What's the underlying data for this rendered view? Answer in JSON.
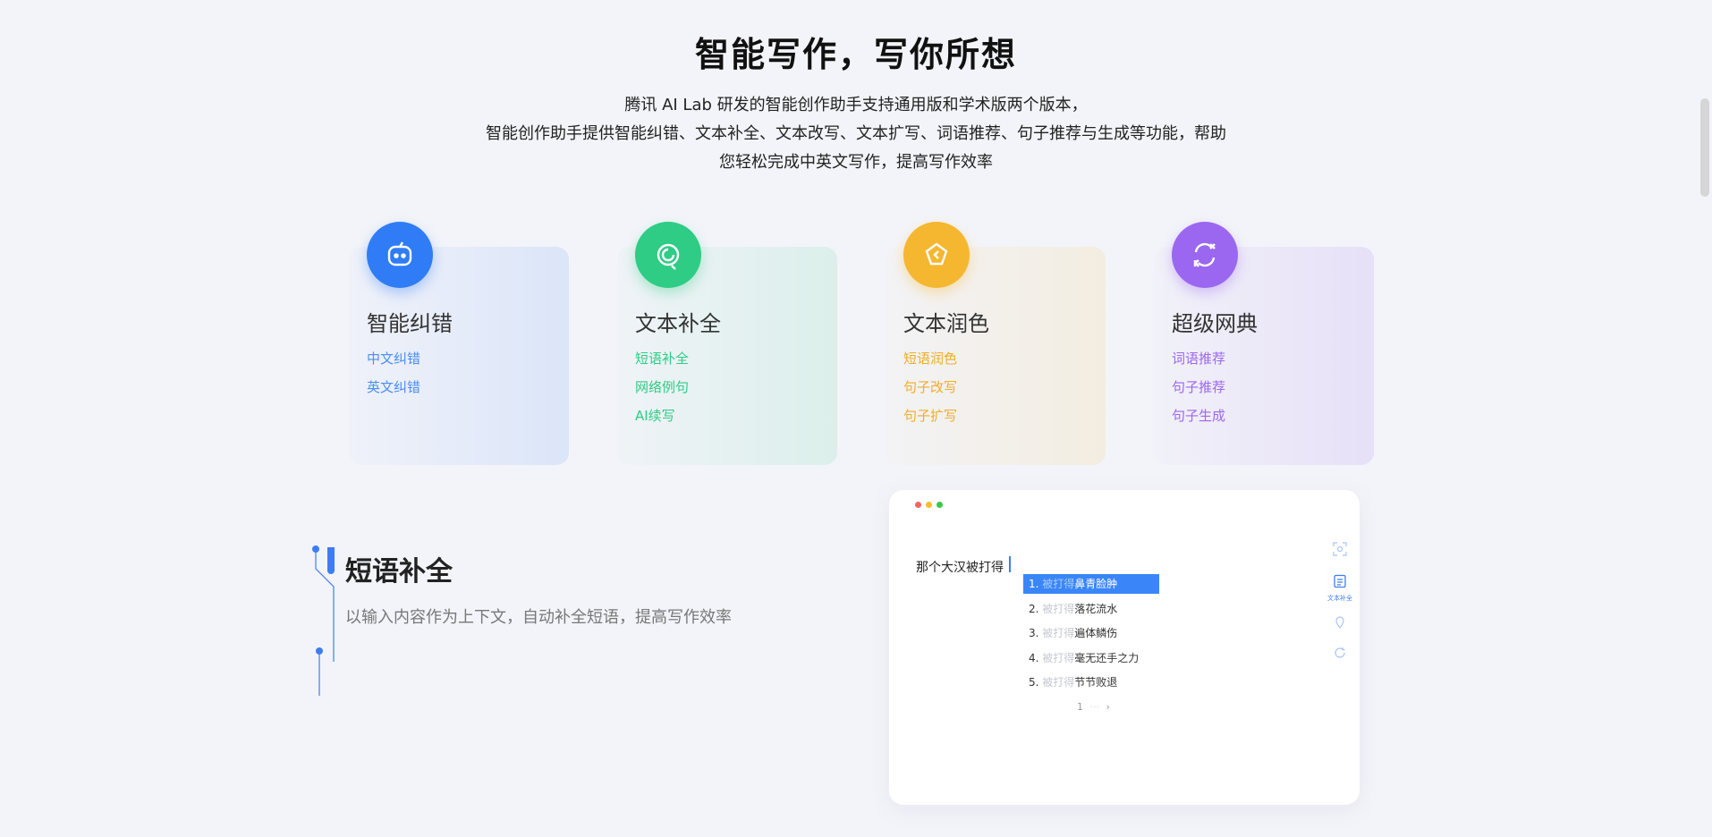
{
  "hero": {
    "title": "智能写作，写你所想",
    "desc_line1": "腾讯 AI Lab 研发的智能创作助手支持通用版和学术版两个版本，",
    "desc_line2": "智能创作助手提供智能纠错、文本补全、文本改写、文本扩写、词语推荐、句子推荐与生成等功能，帮助",
    "desc_line3": "您轻松完成中英文写作，提高写作效率"
  },
  "cards": [
    {
      "title": "智能纠错",
      "icon": "robot-face-icon",
      "accent": "#2f7cf6",
      "links": [
        "中文纠错",
        "英文纠错"
      ]
    },
    {
      "title": "文本补全",
      "icon": "refresh-circle-icon",
      "accent": "#2ecc85",
      "links": [
        "短语补全",
        "网络例句",
        "AI续写"
      ]
    },
    {
      "title": "文本润色",
      "icon": "diamond-icon",
      "accent": "#f5b730",
      "links": [
        "短语润色",
        "句子改写",
        "句子扩写"
      ]
    },
    {
      "title": "超级网典",
      "icon": "translate-cycle-icon",
      "accent": "#9b67f0",
      "links": [
        "词语推荐",
        "句子推荐",
        "句子生成"
      ]
    }
  ],
  "feature": {
    "title": "短语补全",
    "desc": "以输入内容作为上下文，自动补全短语，提高写作效率"
  },
  "preview": {
    "editor_text": "那个大汉被打得",
    "suggestions": [
      {
        "num": "1.",
        "prefix": "被打得",
        "text": "鼻青脸肿"
      },
      {
        "num": "2.",
        "prefix": "被打得",
        "text": "落花流水"
      },
      {
        "num": "3.",
        "prefix": "被打得",
        "text": "遍体鳞伤"
      },
      {
        "num": "4.",
        "prefix": "被打得",
        "text": "毫无还手之力"
      },
      {
        "num": "5.",
        "prefix": "被打得",
        "text": "节节败退"
      }
    ],
    "pager_page": "1",
    "pager_sep": "···",
    "pager_next": "›",
    "side_label": "文本补全"
  }
}
